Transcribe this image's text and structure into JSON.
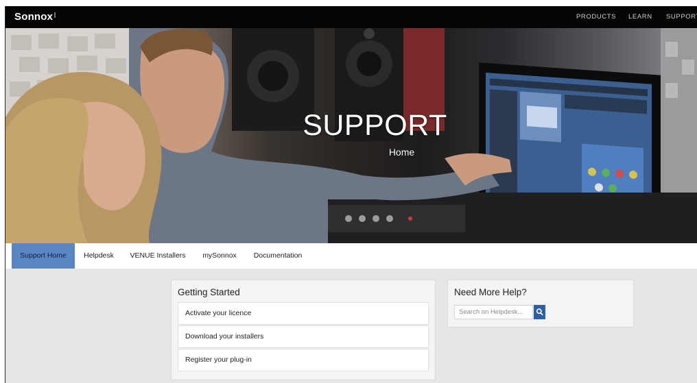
{
  "brand": {
    "logo": "Sonnox"
  },
  "nav": {
    "links": [
      "PRODUCTS",
      "LEARN",
      "SUPPORT"
    ]
  },
  "hero": {
    "title": "SUPPORT",
    "subtitle": "Home"
  },
  "tabs": [
    {
      "label": "Support Home",
      "active": true
    },
    {
      "label": "Helpdesk",
      "active": false
    },
    {
      "label": "VENUE Installers",
      "active": false
    },
    {
      "label": "mySonnox",
      "active": false
    },
    {
      "label": "Documentation",
      "active": false
    }
  ],
  "getting_started": {
    "title": "Getting Started",
    "items": [
      "Activate your licence",
      "Download your installers",
      "Register your plug-in"
    ]
  },
  "help": {
    "title": "Need More Help?",
    "search_placeholder": "Search on Helpdesk...",
    "search_icon": "search-icon"
  },
  "colors": {
    "nav_bg": "#050505",
    "accent": "#5b86c5",
    "search_button": "#2f5f9f",
    "page_bg": "#e5e6e8"
  }
}
